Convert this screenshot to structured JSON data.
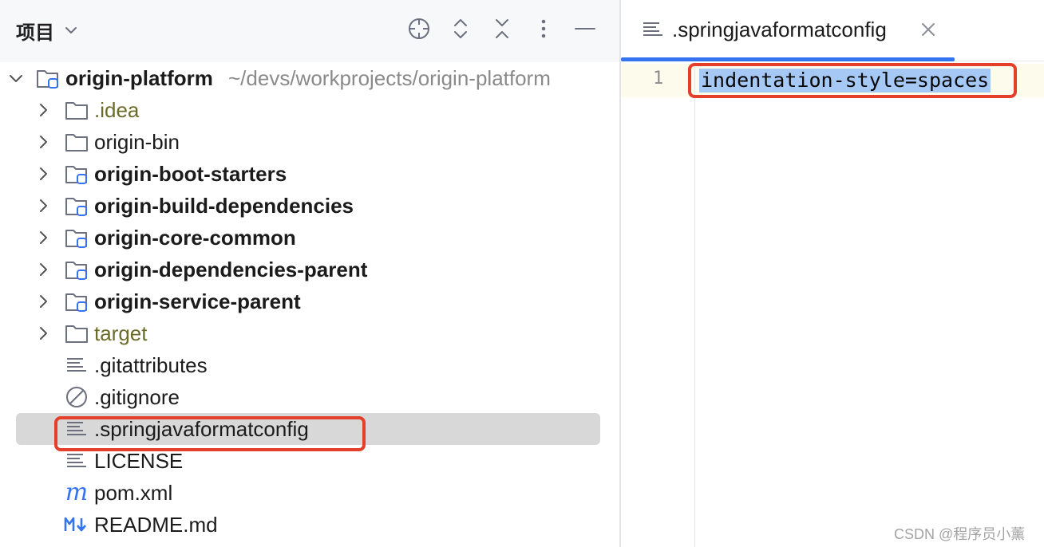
{
  "panel": {
    "title": "项目",
    "icons": [
      "locate-icon",
      "expand-collapse-icon",
      "collapse-all-icon",
      "more-options-icon",
      "minimize-icon"
    ]
  },
  "tree": {
    "root": {
      "name": "origin-platform",
      "path": "~/devs/workprojects/origin-platform"
    },
    "items": [
      {
        "label": ".idea",
        "type": "folder"
      },
      {
        "label": "origin-bin",
        "type": "folder"
      },
      {
        "label": "origin-boot-starters",
        "type": "module"
      },
      {
        "label": "origin-build-dependencies",
        "type": "module"
      },
      {
        "label": "origin-core-common",
        "type": "module"
      },
      {
        "label": "origin-dependencies-parent",
        "type": "module"
      },
      {
        "label": "origin-service-parent",
        "type": "module"
      },
      {
        "label": "target",
        "type": "folder"
      },
      {
        "label": ".gitattributes",
        "type": "text-file"
      },
      {
        "label": ".gitignore",
        "type": "ignore-file"
      },
      {
        "label": ".springjavaformatconfig",
        "type": "text-file",
        "selected": true
      },
      {
        "label": "LICENSE",
        "type": "text-file"
      },
      {
        "label": "pom.xml",
        "type": "maven-file"
      },
      {
        "label": "README.md",
        "type": "markdown-file"
      }
    ]
  },
  "editor": {
    "tab": {
      "label": ".springjavaformatconfig"
    },
    "lines": [
      {
        "number": "1",
        "text": "indentation-style=spaces"
      }
    ]
  },
  "watermark": "CSDN @程序员小薰",
  "colors": {
    "accent": "#3574f0",
    "highlight_box": "#e43f2a",
    "selection": "#a6c8f5",
    "selected_row": "#d8d8d8",
    "excluded_folder": "#6b6b2a"
  }
}
